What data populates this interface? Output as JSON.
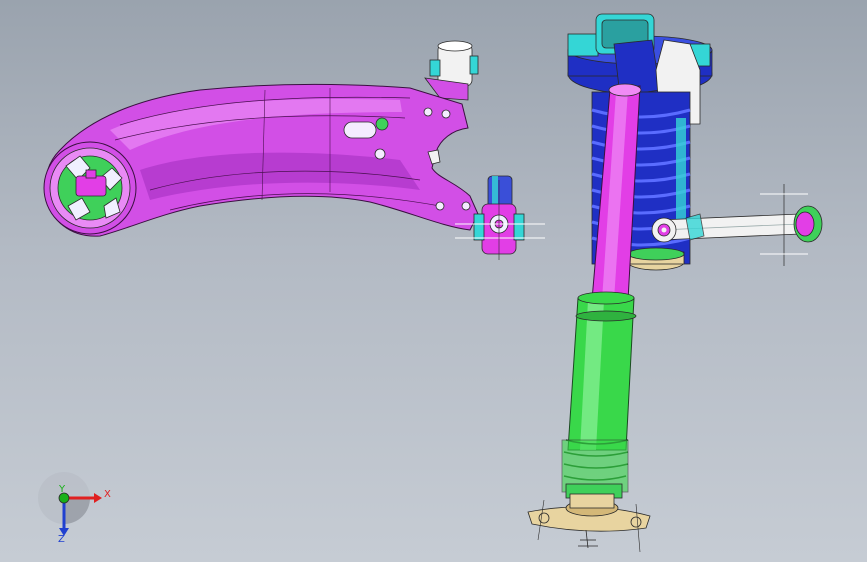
{
  "viewport": {
    "background_top": "#9aa3ae",
    "background_bottom": "#c6ccd4"
  },
  "colors": {
    "control_arm": "#d24fe6",
    "control_arm_shade": "#a12dbd",
    "bushing_green": "#3fd05a",
    "spring_blue": "#1f2fc4",
    "shock_rod": "#e23ee6",
    "shock_body": "#39d84a",
    "mount_tan": "#e8d4a0",
    "cyan": "#34d6d6",
    "link_white": "#f2f2f2"
  },
  "parts": [
    {
      "name": "lower-control-arm"
    },
    {
      "name": "coilover-shock-absorber"
    },
    {
      "name": "stabilizer-link"
    }
  ],
  "triad": {
    "x_label": "X",
    "y_label": "Y",
    "z_label": "Z",
    "x_color": "#e02020",
    "y_color": "#18b018",
    "z_color": "#2040d0"
  }
}
